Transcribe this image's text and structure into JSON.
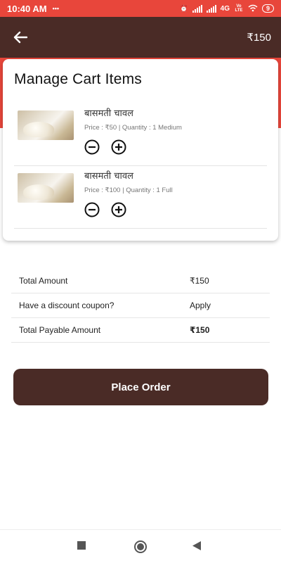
{
  "status_bar": {
    "time": "10:40 AM",
    "network": "4G",
    "volte": "Vo LTE",
    "battery": "9"
  },
  "app_bar": {
    "back_icon": "arrow-left-icon",
    "cart_total": "₹150"
  },
  "cart": {
    "title": "Manage Cart Items",
    "items": [
      {
        "name": "बासमती चावल",
        "meta": "Price : ₹50 | Quantity : 1 Medium",
        "image": "rice-sack-image"
      },
      {
        "name": "बासमती चावल",
        "meta": "Price : ₹100 | Quantity : 1 Full",
        "image": "rice-sack-image"
      }
    ]
  },
  "summary": {
    "total_amount_label": "Total Amount",
    "total_amount_value": "₹150",
    "coupon_label": "Have a discount coupon?",
    "coupon_action": "Apply",
    "payable_label": "Total Payable Amount",
    "payable_value": "₹150"
  },
  "actions": {
    "place_order": "Place Order"
  },
  "colors": {
    "accent_red": "#e8463b",
    "brand_brown": "#4a2b26"
  }
}
